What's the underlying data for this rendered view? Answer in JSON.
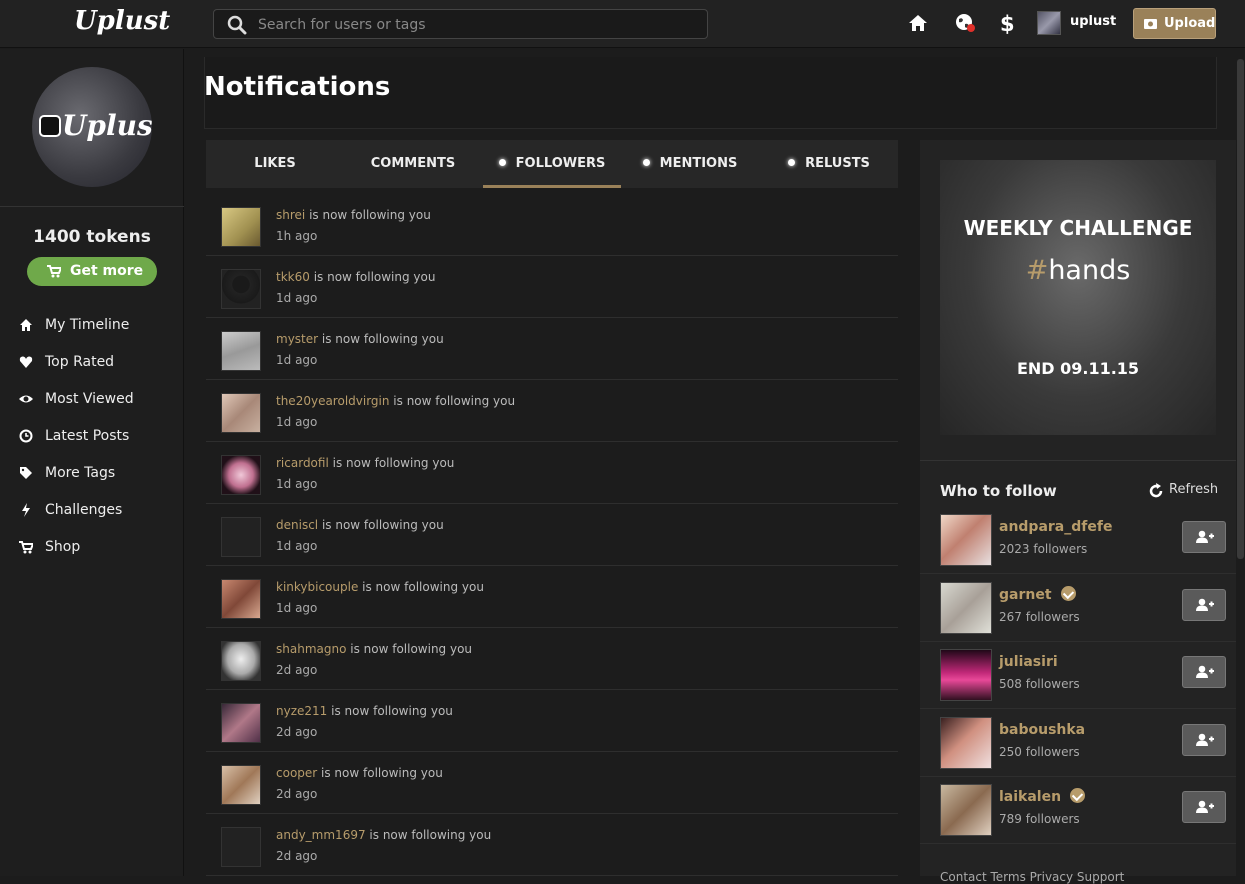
{
  "app": {
    "logo": "Uplust",
    "colors": {
      "accent": "#b79c6b",
      "upload_bg": "#9a8159",
      "get_more_bg": "#6fa94a",
      "bg": "#1c1c1c"
    }
  },
  "header": {
    "search_placeholder": "Search for users or tags",
    "username": "uplust",
    "upload_label": "Upload",
    "icons": [
      "home-icon",
      "globe-notification-icon",
      "dollar-icon"
    ]
  },
  "sidebar": {
    "profile_logo": "Uplust",
    "tokens": "1400 tokens",
    "get_more": "Get more",
    "nav": [
      {
        "label": "My Timeline",
        "icon": "home-icon"
      },
      {
        "label": "Top Rated",
        "icon": "heart-icon"
      },
      {
        "label": "Most Viewed",
        "icon": "eye-icon"
      },
      {
        "label": "Latest Posts",
        "icon": "clock-icon"
      },
      {
        "label": "More Tags",
        "icon": "tag-icon"
      },
      {
        "label": "Challenges",
        "icon": "bolt-icon"
      },
      {
        "label": "Shop",
        "icon": "cart-icon"
      }
    ]
  },
  "main": {
    "title": "Notifications",
    "tabs": [
      {
        "label": "LIKES",
        "dot": false,
        "active": false
      },
      {
        "label": "COMMENTS",
        "dot": false,
        "active": false
      },
      {
        "label": "FOLLOWERS",
        "dot": true,
        "active": true
      },
      {
        "label": "MENTIONS",
        "dot": true,
        "active": false
      },
      {
        "label": "RELUSTS",
        "dot": true,
        "active": false
      }
    ],
    "follow_text": " is now following you",
    "notifications": [
      {
        "user": "shrei",
        "time": "1h ago"
      },
      {
        "user": "tkk60",
        "time": "1d ago"
      },
      {
        "user": "myster",
        "time": "1d ago"
      },
      {
        "user": "the20yearoldvirgin",
        "time": "1d ago"
      },
      {
        "user": "ricardofil",
        "time": "1d ago"
      },
      {
        "user": "deniscl",
        "time": "1d ago"
      },
      {
        "user": "kinkybicouple",
        "time": "1d ago"
      },
      {
        "user": "shahmagno",
        "time": "2d ago"
      },
      {
        "user": "nyze211",
        "time": "2d ago"
      },
      {
        "user": "cooper",
        "time": "2d ago"
      },
      {
        "user": "andy_mm1697",
        "time": "2d ago"
      }
    ]
  },
  "right": {
    "challenge": {
      "title": "WEEKLY CHALLENGE",
      "hash": "#",
      "tag": "hands",
      "end": "END 09.11.15"
    },
    "who_to_follow": "Who to follow",
    "refresh": "Refresh",
    "suggestions": [
      {
        "name": "andpara_dfefe",
        "followers": "2023 followers",
        "verified": false
      },
      {
        "name": "garnet",
        "followers": "267 followers",
        "verified": true
      },
      {
        "name": "juliasiri",
        "followers": "508 followers",
        "verified": false
      },
      {
        "name": "baboushka",
        "followers": "250 followers",
        "verified": false
      },
      {
        "name": "laikalen",
        "followers": "789 followers",
        "verified": true
      }
    ],
    "footer": "Contact   Terms   Privacy   Support"
  }
}
